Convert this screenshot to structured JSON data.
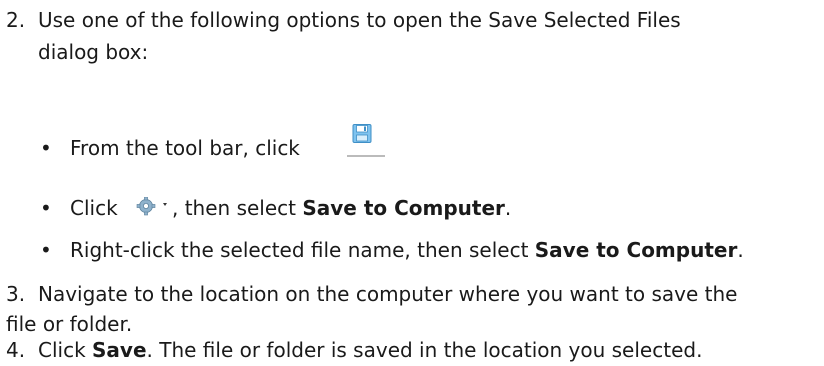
{
  "steps": {
    "step2": {
      "number": "2.",
      "line1": "Use one of the following options to open the Save Selected Files",
      "line2": "dialog box:"
    },
    "bullets": {
      "b1": {
        "text": "From the tool bar, click"
      },
      "b2": {
        "pre": "Click",
        "mid": ", then select",
        "bold": "Save to Computer",
        "post": "."
      },
      "b3": {
        "pre": "Right-click the selected file name, then select",
        "bold": "Save to Computer",
        "post": "."
      }
    },
    "step3": {
      "number": "3.",
      "line1": "Navigate to the location on the computer where you want to save the",
      "line2": "file or folder."
    },
    "step4": {
      "number": "4.",
      "pre": "Click",
      "bold": "Save",
      "post": ". The file or folder is saved in the location you selected."
    }
  },
  "icons": {
    "save": "floppy-disk-icon",
    "settings": "gear-dropdown-icon"
  }
}
